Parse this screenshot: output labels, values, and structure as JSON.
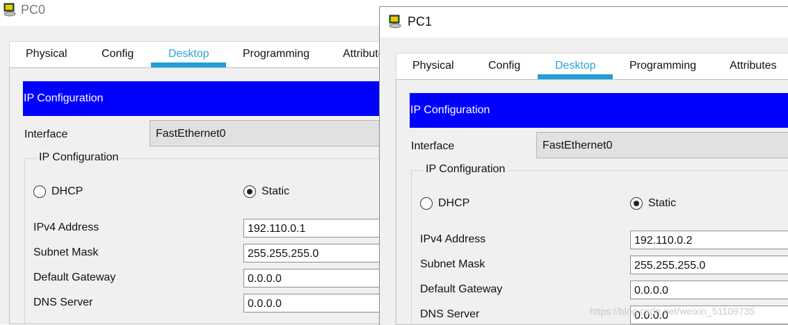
{
  "windows": [
    {
      "title": "PC0",
      "tabs": [
        "Physical",
        "Config",
        "Desktop",
        "Programming",
        "Attributes"
      ],
      "active_tab": "Desktop",
      "banner": "IP Configuration",
      "interface_label": "Interface",
      "interface_value": "FastEthernet0",
      "group_title": "IP Configuration",
      "dhcp_label": "DHCP",
      "static_label": "Static",
      "selected_mode": "Static",
      "fields": [
        {
          "label": "IPv4 Address",
          "value": "192.110.0.1"
        },
        {
          "label": "Subnet Mask",
          "value": "255.255.255.0"
        },
        {
          "label": "Default Gateway",
          "value": "0.0.0.0"
        },
        {
          "label": "DNS Server",
          "value": "0.0.0.0"
        }
      ]
    },
    {
      "title": "PC1",
      "tabs": [
        "Physical",
        "Config",
        "Desktop",
        "Programming",
        "Attributes"
      ],
      "active_tab": "Desktop",
      "banner": "IP Configuration",
      "interface_label": "Interface",
      "interface_value": "FastEthernet0",
      "group_title": "IP Configuration",
      "dhcp_label": "DHCP",
      "static_label": "Static",
      "selected_mode": "Static",
      "fields": [
        {
          "label": "IPv4 Address",
          "value": "192.110.0.2"
        },
        {
          "label": "Subnet Mask",
          "value": "255.255.255.0"
        },
        {
          "label": "Default Gateway",
          "value": "0.0.0.0"
        },
        {
          "label": "DNS Server",
          "value": "0.0.0.0"
        }
      ]
    }
  ],
  "watermark": "https://blog.csdn.net/weixin_51109735",
  "colors": {
    "banner": "#0000ff",
    "active_tab": "#2aa6d6",
    "tab_underline": "#1f9ed8"
  }
}
